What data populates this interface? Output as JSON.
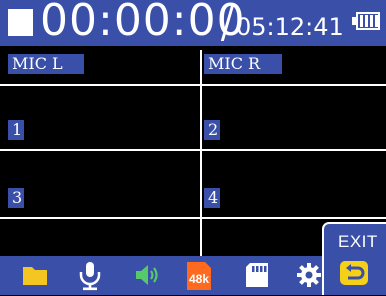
{
  "recorder": {
    "elapsed_time": "00:00:00",
    "remaining_time": "05:12:41"
  },
  "channels": [
    {
      "label": "MIC L"
    },
    {
      "label": "MIC R"
    },
    {
      "label": "1"
    },
    {
      "label": "2"
    },
    {
      "label": "3"
    },
    {
      "label": "4"
    }
  ],
  "toolbar": {
    "icons": [
      "folder-icon",
      "microphone-icon",
      "speaker-icon",
      "sample-rate-48k-icon",
      "sd-card-icon",
      "gear-icon"
    ],
    "sample_rate_label": "48k",
    "exit_label": "EXIT"
  },
  "colors": {
    "accent_blue": "#3a4fa8",
    "folder_yellow": "#f3c622",
    "green": "#56c96a",
    "orange": "#ff6a1e",
    "exit_yellow": "#f5d019"
  }
}
